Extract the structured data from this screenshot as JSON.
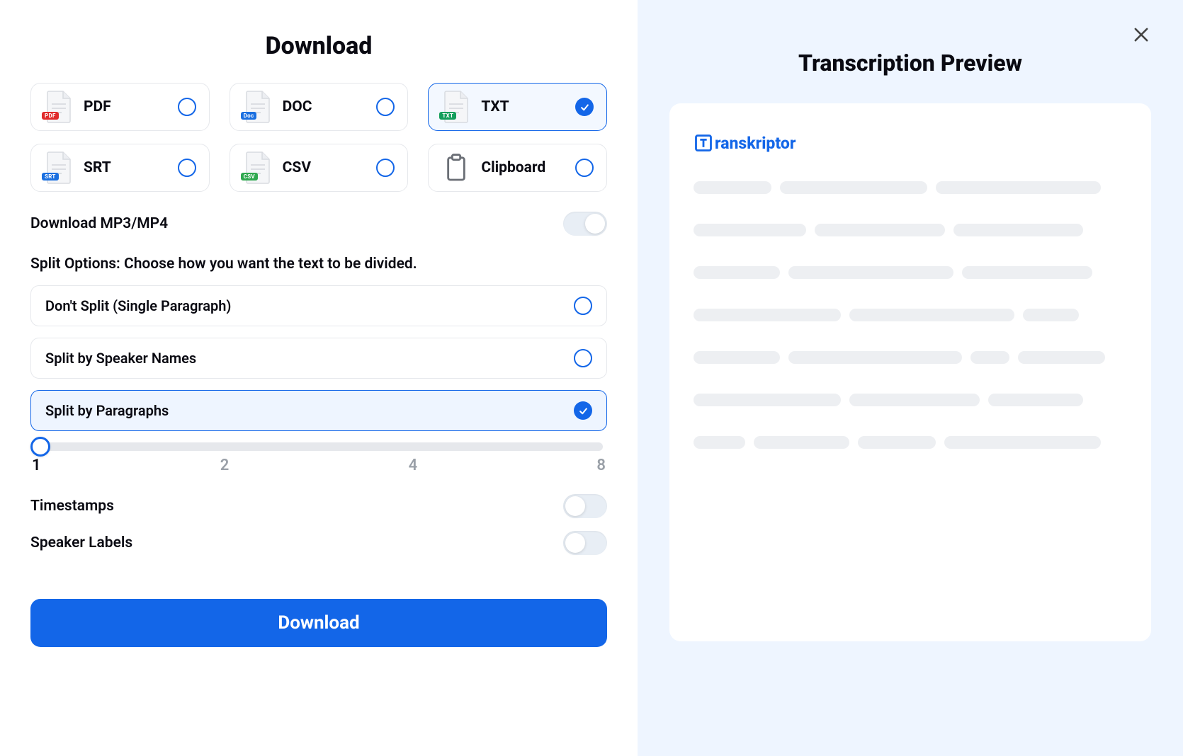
{
  "left": {
    "title": "Download",
    "formats": [
      {
        "key": "pdf",
        "label": "PDF",
        "badge": "PDF",
        "badgeClass": "badge-pdf",
        "selected": false,
        "icon": "file"
      },
      {
        "key": "doc",
        "label": "DOC",
        "badge": "Doc",
        "badgeClass": "badge-doc",
        "selected": false,
        "icon": "file"
      },
      {
        "key": "txt",
        "label": "TXT",
        "badge": "TXT",
        "badgeClass": "badge-txt",
        "selected": true,
        "icon": "file"
      },
      {
        "key": "srt",
        "label": "SRT",
        "badge": "SRT",
        "badgeClass": "badge-srt",
        "selected": false,
        "icon": "file"
      },
      {
        "key": "csv",
        "label": "CSV",
        "badge": "CSV",
        "badgeClass": "badge-csv",
        "selected": false,
        "icon": "file"
      },
      {
        "key": "clipboard",
        "label": "Clipboard",
        "badge": "",
        "badgeClass": "",
        "selected": false,
        "icon": "clipboard"
      }
    ],
    "mp3Toggle": {
      "label": "Download MP3/MP4",
      "on": true
    },
    "splitSection": "Split Options: Choose how you want the text to be divided.",
    "splitOptions": [
      {
        "label": "Don't Split (Single Paragraph)",
        "selected": false
      },
      {
        "label": "Split by Speaker Names",
        "selected": false
      },
      {
        "label": "Split by Paragraphs",
        "selected": true
      }
    ],
    "slider": {
      "ticks": [
        "1",
        "2",
        "4",
        "8"
      ],
      "valueIndex": 0
    },
    "timestamps": {
      "label": "Timestamps",
      "on": false
    },
    "speakerLabels": {
      "label": "Speaker Labels",
      "on": false
    },
    "button": "Download"
  },
  "right": {
    "title": "Transcription Preview",
    "brand": "ranskriptor",
    "skeleton": [
      [
        [
          18
        ],
        [
          34
        ],
        [
          38
        ]
      ],
      [
        [
          26
        ],
        [
          30
        ],
        [
          30
        ]
      ],
      [
        [
          20
        ],
        [
          38
        ],
        [
          30
        ]
      ],
      [
        [
          34
        ],
        [
          38
        ],
        [
          13
        ]
      ],
      [
        [
          20
        ],
        [
          40
        ],
        [
          9
        ],
        [
          20
        ]
      ],
      [
        [
          34
        ],
        [
          30
        ],
        [
          22
        ]
      ],
      [
        [
          12
        ],
        [
          22
        ],
        [
          18
        ],
        [
          36
        ]
      ]
    ]
  },
  "colors": {
    "accent": "#1366e8"
  }
}
